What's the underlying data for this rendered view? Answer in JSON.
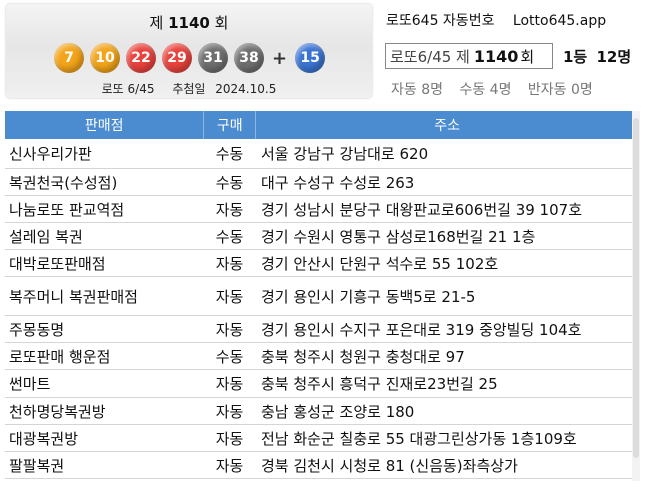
{
  "draw": {
    "round_prefix": "제",
    "round_number": "1140",
    "round_suffix": "회",
    "balls": [
      {
        "number": "7",
        "color": "yellow"
      },
      {
        "number": "10",
        "color": "yellow"
      },
      {
        "number": "22",
        "color": "red"
      },
      {
        "number": "29",
        "color": "red"
      },
      {
        "number": "31",
        "color": "gray"
      },
      {
        "number": "38",
        "color": "gray"
      }
    ],
    "plus": "+",
    "bonus": {
      "number": "15",
      "color": "blue"
    },
    "game_label": "로또 6/45",
    "date_label": "추첨일",
    "date": "2024.10.5"
  },
  "app": {
    "title": "로또645 자동번호",
    "site": "Lotto645.app"
  },
  "search": {
    "prefix": "로또6/45 제",
    "round": "1140",
    "suffix": "회"
  },
  "winners": {
    "rank": "1등",
    "count": "12명",
    "auto": "자동 8명",
    "manual": "수동 4명",
    "semi": "반자동 0명"
  },
  "table": {
    "headers": [
      "판매점",
      "구매",
      "주소"
    ],
    "rows": [
      {
        "store": "신사우리가판",
        "type": "수동",
        "address": "서울 강남구 강남대로 620"
      },
      {
        "store": "복권천국(수성점)",
        "type": "수동",
        "address": "대구 수성구 수성로 263"
      },
      {
        "store": "나눔로또 판교역점",
        "type": "자동",
        "address": "경기 성남시 분당구 대왕판교로606번길 39 107호"
      },
      {
        "store": "설레임 복권",
        "type": "수동",
        "address": "경기 수원시 영통구 삼성로168번길 21 1층"
      },
      {
        "store": "대박로또판매점",
        "type": "자동",
        "address": "경기 안산시 단원구 석수로 55 102호"
      },
      {
        "store": "복주머니 복권판매점",
        "type": "자동",
        "address": "경기 용인시 기흥구 동백5로 21-5"
      },
      {
        "store": "주몽동명",
        "type": "자동",
        "address": "경기 용인시 수지구 포은대로 319 중앙빌딩 104호"
      },
      {
        "store": "로또판매 행운점",
        "type": "수동",
        "address": "충북 청주시 청원구 충청대로 97"
      },
      {
        "store": "썬마트",
        "type": "자동",
        "address": "충북 청주시 흥덕구 진재로23번길 25"
      },
      {
        "store": "천하명당복권방",
        "type": "자동",
        "address": "충남 홍성군 조양로 180"
      },
      {
        "store": "대광복권방",
        "type": "자동",
        "address": "전남 화순군 칠충로 55 대광그린상가동 1층109호"
      },
      {
        "store": "팔팔복권",
        "type": "자동",
        "address": "경북 김천시 시청로 81 (신음동)좌측상가"
      }
    ]
  },
  "colors": {
    "header_bg": "#4b8bd0",
    "ball_yellow": "#f3a41b",
    "ball_red": "#e9433d",
    "ball_gray": "#6f6f6f",
    "ball_blue": "#3a74d2"
  }
}
